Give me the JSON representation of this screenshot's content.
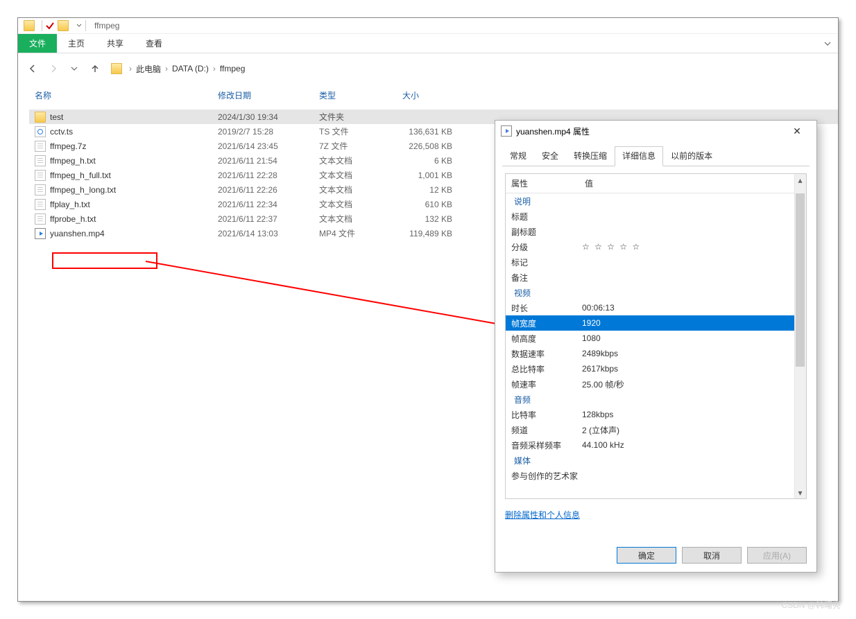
{
  "window": {
    "title": "ffmpeg"
  },
  "ribbon": {
    "tabs": [
      "文件",
      "主页",
      "共享",
      "查看"
    ]
  },
  "breadcrumb": {
    "items": [
      "此电脑",
      "DATA (D:)",
      "ffmpeg"
    ]
  },
  "columns": {
    "name": "名称",
    "modified": "修改日期",
    "type": "类型",
    "size": "大小"
  },
  "files": [
    {
      "icon": "folder",
      "name": "test",
      "date": "2024/1/30 19:34",
      "type": "文件夹",
      "size": ""
    },
    {
      "icon": "videop",
      "name": "cctv.ts",
      "date": "2019/2/7 15:28",
      "type": "TS 文件",
      "size": "136,631 KB"
    },
    {
      "icon": "file",
      "name": "ffmpeg.7z",
      "date": "2021/6/14 23:45",
      "type": "7Z 文件",
      "size": "226,508 KB"
    },
    {
      "icon": "file",
      "name": "ffmpeg_h.txt",
      "date": "2021/6/11 21:54",
      "type": "文本文档",
      "size": "6 KB"
    },
    {
      "icon": "file",
      "name": "ffmpeg_h_full.txt",
      "date": "2021/6/11 22:28",
      "type": "文本文档",
      "size": "1,001 KB"
    },
    {
      "icon": "file",
      "name": "ffmpeg_h_long.txt",
      "date": "2021/6/11 22:26",
      "type": "文本文档",
      "size": "12 KB"
    },
    {
      "icon": "file",
      "name": "ffplay_h.txt",
      "date": "2021/6/11 22:34",
      "type": "文本文档",
      "size": "610 KB"
    },
    {
      "icon": "file",
      "name": "ffprobe_h.txt",
      "date": "2021/6/11 22:37",
      "type": "文本文档",
      "size": "132 KB"
    },
    {
      "icon": "video",
      "name": "yuanshen.mp4",
      "date": "2021/6/14 13:03",
      "type": "MP4 文件",
      "size": "119,489 KB"
    }
  ],
  "props": {
    "title": "yuanshen.mp4 属性",
    "tabs": [
      "常规",
      "安全",
      "转换压缩",
      "详细信息",
      "以前的版本"
    ],
    "header": {
      "prop": "属性",
      "val": "值"
    },
    "sections": {
      "desc": "说明",
      "video_sec": "视频",
      "audio_sec": "音频",
      "media_sec": "媒体"
    },
    "rows": {
      "title_label": "标题",
      "subtitle_label": "副标题",
      "rating_label": "分级",
      "tag_label": "标记",
      "remark_label": "备注",
      "duration_label": "时长",
      "duration_val": "00:06:13",
      "framew_label": "帧宽度",
      "framew_val": "1920",
      "frameh_label": "帧高度",
      "frameh_val": "1080",
      "datarate_label": "数据速率",
      "datarate_val": "2489kbps",
      "totalrate_label": "总比特率",
      "totalrate_val": "2617kbps",
      "fps_label": "帧速率",
      "fps_val": "25.00 帧/秒",
      "abr_label": "比特率",
      "abr_val": "128kbps",
      "channel_label": "频道",
      "channel_val": "2 (立体声)",
      "asample_label": "音频采样频率",
      "asample_val": "44.100 kHz",
      "artist_label": "参与创作的艺术家"
    },
    "link": "删除属性和个人信息",
    "buttons": {
      "ok": "确定",
      "cancel": "取消",
      "apply": "应用(A)"
    }
  },
  "watermark": "CSDN @韩曙亮"
}
